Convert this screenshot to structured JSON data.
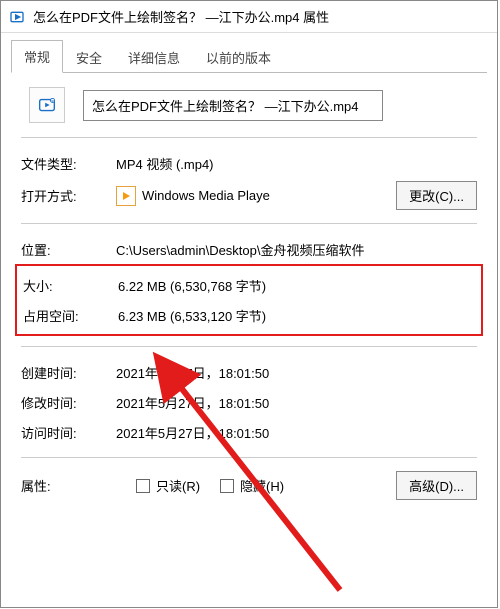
{
  "titlebar": {
    "title": "怎么在PDF文件上绘制签名？ —江下办公.mp4 属性"
  },
  "tabs": {
    "general": "常规",
    "security": "安全",
    "details": "详细信息",
    "previous": "以前的版本"
  },
  "file": {
    "name": "怎么在PDF文件上绘制签名？ —江下办公.mp4"
  },
  "labels": {
    "filetype": "文件类型:",
    "openwith": "打开方式:",
    "location": "位置:",
    "size": "大小:",
    "sizeondisk": "占用空间:",
    "created": "创建时间:",
    "modified": "修改时间:",
    "accessed": "访问时间:",
    "attributes": "属性:"
  },
  "values": {
    "filetype": "MP4 视频 (.mp4)",
    "openwith_app": "Windows Media Playe",
    "location": "C:\\Users\\admin\\Desktop\\金舟视频压缩软件",
    "size": "6.22 MB (6,530,768 字节)",
    "sizeondisk": "6.23 MB (6,533,120 字节)",
    "created": "2021年5月27日，18:01:50",
    "modified": "2021年5月27日，18:01:50",
    "accessed": "2021年5月27日，18:01:50"
  },
  "buttons": {
    "change": "更改(C)...",
    "advanced": "高级(D)..."
  },
  "checkboxes": {
    "readonly": "只读(R)",
    "hidden": "隐藏(H)"
  }
}
